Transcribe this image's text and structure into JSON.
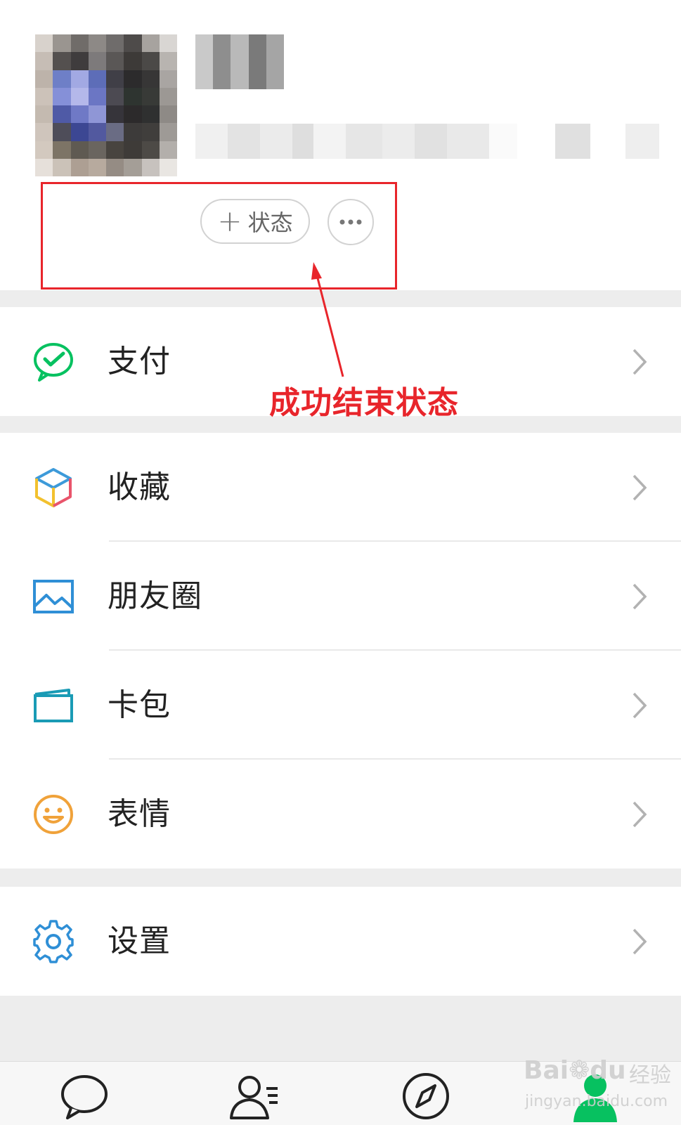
{
  "profile": {
    "status_button": {
      "plus": "+",
      "label": "状态"
    },
    "more_button": {
      "icon": "more-dots-icon"
    }
  },
  "menu": {
    "pay": {
      "label": "支付",
      "icon": "wechat-pay-icon"
    },
    "favorites": {
      "label": "收藏",
      "icon": "cube-icon"
    },
    "moments": {
      "label": "朋友圈",
      "icon": "image-icon"
    },
    "cards": {
      "label": "卡包",
      "icon": "card-wallet-icon"
    },
    "stickers": {
      "label": "表情",
      "icon": "smile-icon"
    },
    "settings": {
      "label": "设置",
      "icon": "gear-icon"
    }
  },
  "annotation": {
    "text": "成功结束状态"
  },
  "tabbar": {
    "tabs": [
      {
        "icon": "chat-bubble-icon",
        "active": false
      },
      {
        "icon": "contacts-icon",
        "active": false
      },
      {
        "icon": "compass-icon",
        "active": false
      },
      {
        "icon": "me-icon",
        "active": true
      }
    ]
  },
  "watermark": {
    "brand": "Bai",
    "brand_suffix": "du",
    "product": "经验",
    "url": "jingyan.baidu.com"
  },
  "colors": {
    "accent_green": "#07c160",
    "annotation_red": "#e8252b",
    "page_bg": "#ededed",
    "cell_bg": "#ffffff"
  }
}
